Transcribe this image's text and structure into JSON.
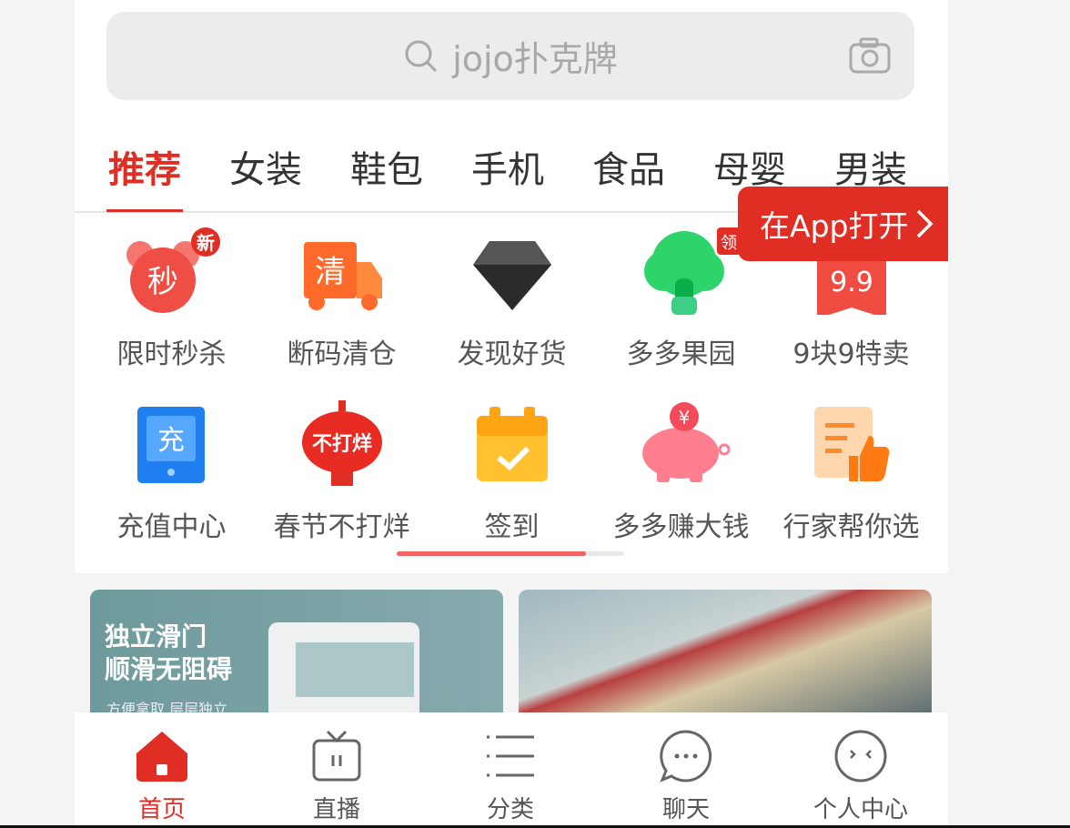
{
  "search": {
    "placeholder": "jojo扑克牌",
    "icon": "search-icon",
    "camera_icon": "camera-icon"
  },
  "tabs": [
    {
      "label": "推荐",
      "active": true
    },
    {
      "label": "女装"
    },
    {
      "label": "鞋包"
    },
    {
      "label": "手机"
    },
    {
      "label": "食品"
    },
    {
      "label": "母婴"
    },
    {
      "label": "男装"
    }
  ],
  "open_app": {
    "label": "在App打开"
  },
  "shortcuts": [
    {
      "label": "限时秒杀",
      "icon": "alarm-clock-icon",
      "icon_text": "秒",
      "badge": "新"
    },
    {
      "label": "断码清仓",
      "icon": "truck-icon",
      "icon_text": "清"
    },
    {
      "label": "发现好货",
      "icon": "diamond-icon"
    },
    {
      "label": "多多果园",
      "icon": "tree-icon",
      "badge": "领"
    },
    {
      "label": "9块9特卖",
      "icon": "ribbon-tag-icon",
      "icon_text": "9.9"
    },
    {
      "label": "充值中心",
      "icon": "tablet-icon",
      "icon_text": "充"
    },
    {
      "label": "春节不打烊",
      "icon": "lantern-icon",
      "icon_text": "不打烊"
    },
    {
      "label": "签到",
      "icon": "calendar-check-icon"
    },
    {
      "label": "多多赚大钱",
      "icon": "piggy-bank-icon",
      "icon_text": "¥"
    },
    {
      "label": "行家帮你选",
      "icon": "thumbs-up-doc-icon"
    }
  ],
  "scroll_progress": 0.83,
  "banners": [
    {
      "title_line1": "独立滑门",
      "title_line2": "顺滑无阻碍",
      "subtitle": "方便拿取 层层独立"
    },
    {}
  ],
  "bottom_nav": [
    {
      "label": "首页",
      "icon": "home-icon",
      "active": true
    },
    {
      "label": "直播",
      "icon": "tv-icon"
    },
    {
      "label": "分类",
      "icon": "list-icon"
    },
    {
      "label": "聊天",
      "icon": "chat-icon"
    },
    {
      "label": "个人中心",
      "icon": "face-icon"
    }
  ],
  "colors": {
    "accent": "#e02e24",
    "background": "#f4f4f4"
  }
}
